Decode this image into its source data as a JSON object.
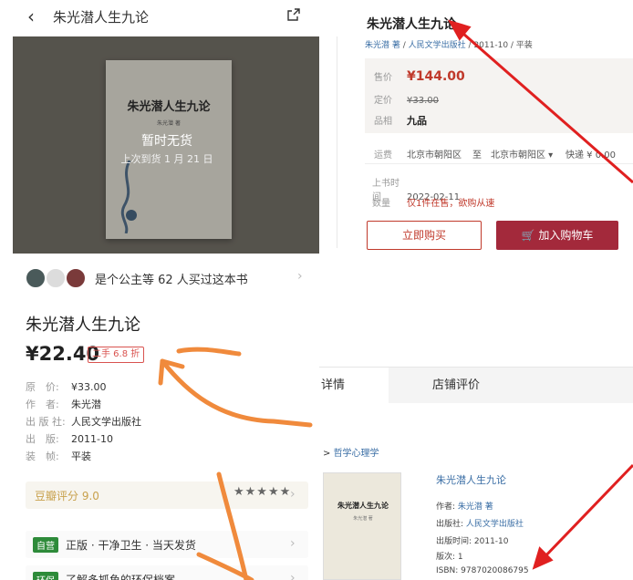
{
  "mobile": {
    "top_title": "朱光潜人生九论",
    "no_stock": "暂时无货",
    "restock": "上次到货 1 月 21 日",
    "cover_title": "朱光潜人生九论",
    "cover_author": "朱光潜 著",
    "buyers_text": "是个公主等 62 人买过这本书",
    "title": "朱光潜人生九论",
    "price": "¥22.40",
    "badge": "二手 6.8 折",
    "specs": [
      {
        "k": "原　价:",
        "v": "¥33.00"
      },
      {
        "k": "作　者:",
        "v": "朱光潜"
      },
      {
        "k": "出 版 社:",
        "v": "人民文学出版社"
      },
      {
        "k": "出　版:",
        "v": "2011-10"
      },
      {
        "k": "装　帧:",
        "v": "平装"
      }
    ],
    "douban": "豆瓣评分 9.0",
    "douban_stars": "★★★★★",
    "promos": [
      {
        "tag": "自营",
        "text": "正版 · 干净卫生 · 当天发货"
      },
      {
        "tag": "环保",
        "text": "了解多抓鱼的环保档案"
      }
    ]
  },
  "web": {
    "title": "朱光潜人生九论",
    "meta_author": "朱光潜 著",
    "meta_publisher": "人民文学出版社",
    "meta_rest": "/ 2011-10 / 平装",
    "price_label": "售价",
    "price": "¥144.00",
    "orig_label": "定价",
    "orig": "¥33.00",
    "cond_label": "品相",
    "cond": "九品",
    "ship_label": "运费",
    "ship_from": "北京市朝阳区",
    "ship_to_word": "至",
    "ship_to": "北京市朝阳区 ▾",
    "ship_fee": "快递 ¥ 0.00",
    "date_label": "上书时间",
    "date": "2022-02-11",
    "qty_label": "数量",
    "qty": "仅1件在售，欲购从速",
    "buy_btn": "立即购买",
    "cart_btn": "加入购物车",
    "tab_detail": "详情",
    "tab_review": "店铺评价",
    "crumb_prefix": "> ",
    "crumb_link": "哲学心理学",
    "thumb_title": "朱光潜人生九论",
    "thumb_author": "朱光潜 著",
    "detail_title": "朱光潜人生九论",
    "detail_rows": [
      {
        "k": "作者: ",
        "v": "朱光潜 著",
        "link": true
      },
      {
        "k": "出版社: ",
        "v": "人民文学出版社",
        "link": true
      },
      {
        "k": "出版时间: ",
        "v": "2011-10",
        "link": false
      },
      {
        "k": "版次: ",
        "v": "1",
        "link": false
      },
      {
        "k": "ISBN: ",
        "v": "9787020086795",
        "link": false
      }
    ]
  },
  "colors": {
    "accent_red": "#c0392b",
    "cart_bg": "#a3293b",
    "link_blue": "#3a6ea5",
    "annot_orange": "#f08a3c",
    "annot_red": "#e02020"
  }
}
